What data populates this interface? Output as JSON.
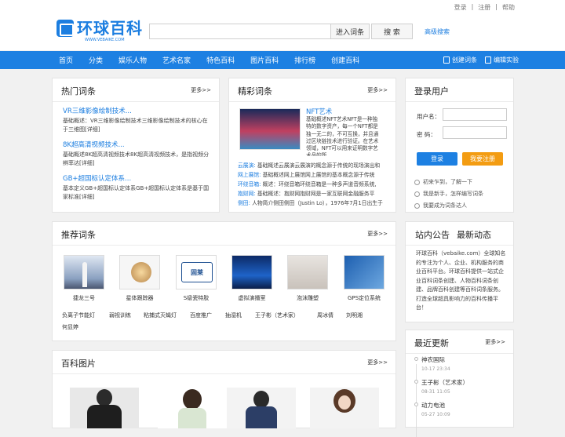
{
  "topbar": {
    "login": "登录",
    "register": "注册",
    "help": "帮助"
  },
  "logo": {
    "text": "环球百科",
    "sub": "WWW.VEBAIKE.COM"
  },
  "search": {
    "value": "",
    "entry_btn": "进入词条",
    "search_btn": "搜 索",
    "advanced": "高级搜索"
  },
  "nav": {
    "items": [
      "首页",
      "分类",
      "娱乐人物",
      "艺术名家",
      "特色百科",
      "图片百科",
      "排行榜",
      "创建百科"
    ],
    "create": "创建词条",
    "edit": "编辑实验"
  },
  "hot": {
    "title": "热门词条",
    "more": "更多>>",
    "items": [
      {
        "t": "VR三维影像绘制技术...",
        "d": "基础概述：VR三维影像绘制技术三维影像绘制技术的核心在于三维图[详细]"
      },
      {
        "t": "8K超高清视频技术...",
        "d": "基础概述8K超高清视频技术8K超高清视频技术，是指视频分辨率达[详细]"
      },
      {
        "t": "GB+超国标认定体系...",
        "d": "基本定义GB+超国标认定体系GB+超国标认定体系是基于国家标准[详细]"
      }
    ]
  },
  "featured": {
    "title": "精彩词条",
    "more": "更多>>",
    "nft_title": "NFT艺术",
    "nft_desc": "基础概述NFT艺术NFT是一种独特的数字资产，每一个NFT都是独一无二的，不可互换，并且通过区块链技术进行验证。在艺术领域，NFT可以用来证明数字艺术品的所",
    "lines": [
      {
        "t": "云展演:",
        "d": "基础概述云展演云展演的概念源于传统的现场演出和"
      },
      {
        "t": "网上展馆:",
        "d": "基础概述网上展馆网上展馆的基本概念源于传统"
      },
      {
        "t": "环绕音箱:",
        "d": "概述：环绕音箱环绕音箱是一种多声道音频系统,"
      },
      {
        "t": "抱财网:",
        "d": "基础概述：抱财网抱财网是一家互联网金融服务平"
      },
      {
        "t": "侧田:",
        "d": "人物简介侧田侧田（Justin Lo），1976年7月1日出生于"
      }
    ]
  },
  "login": {
    "title": "登录用户",
    "user_label": "用户名：",
    "pwd_label": "密  码：",
    "login_btn": "登录",
    "reg_btn": "我要注册",
    "links": [
      "初来乍到，了解一下",
      "我是新手，怎样编写词条",
      "我要成为词条达人"
    ]
  },
  "recommend": {
    "title": "推荐词条",
    "more": "更多>>",
    "items": [
      "捷龙三号",
      "星体跟踪器",
      "S级瓷特胶",
      "虚拟演播室",
      "泡沫雕塑",
      "GPS定位系统"
    ],
    "logo_text": "固莱",
    "keywords": [
      "负离子节能灯",
      "弱视训练",
      "粘捕式灭蝇灯",
      "百度推广",
      "抽湿机",
      "王子彬（艺术家）",
      "周冰倩",
      "刘明湘",
      "何显婷"
    ]
  },
  "notice": {
    "tab1": "站内公告",
    "tab2": "最新动态",
    "text": "环球百科（vebaike.com）全球知名的专注为个人、企业、机构服务的商业百科平台。环球百科提供一站式企业百科词条创建、人物百科词条创建、品牌百科创建等百科词条服务。打造全球超具影响力的百科传播平台！"
  },
  "recent": {
    "title": "最近更新",
    "more": "更多>>",
    "items": [
      {
        "t": "神农国际",
        "d": "10-17 23:34"
      },
      {
        "t": "王子彬（艺术家）",
        "d": "08-31 11:05"
      },
      {
        "t": "动力电池",
        "d": "05-27 10:09"
      }
    ]
  },
  "pictures": {
    "title": "百科图片",
    "more": "更多>>"
  },
  "colors": {
    "brand": "#1d80e2",
    "orange": "#f39c12"
  }
}
